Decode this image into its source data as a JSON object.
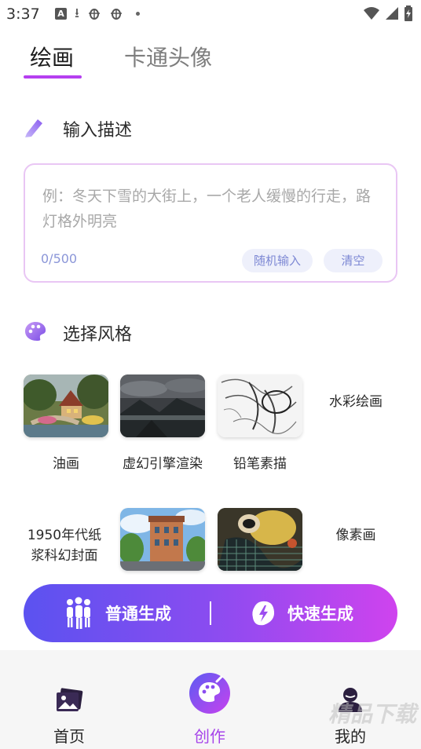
{
  "status_bar": {
    "time": "3:37"
  },
  "tabs": [
    {
      "label": "绘画",
      "active": true
    },
    {
      "label": "卡通头像",
      "active": false
    }
  ],
  "input_section": {
    "title": "输入描述",
    "placeholder": "例：冬天下雪的大街上，一个老人缓慢的行走，路灯格外明亮",
    "count": "0/500",
    "random_label": "随机输入",
    "clear_label": "清空"
  },
  "style_section": {
    "title": "选择风格",
    "styles": [
      {
        "label": "油画",
        "selected": false
      },
      {
        "label": "虚幻引擎渲染",
        "selected": false
      },
      {
        "label": "铅笔素描",
        "selected": false
      },
      {
        "label": "水彩绘画",
        "selected": false
      },
      {
        "label": "1950年代纸浆科幻封面",
        "selected": false
      },
      {
        "label": "",
        "selected": false
      },
      {
        "label": "",
        "selected": false
      },
      {
        "label": "像素画",
        "selected": false
      }
    ]
  },
  "generate": {
    "normal_label": "普通生成",
    "fast_label": "快速生成"
  },
  "bottom_nav": {
    "items": [
      {
        "label": "首页",
        "active": false
      },
      {
        "label": "创作",
        "active": true
      },
      {
        "label": "我的",
        "active": false
      }
    ]
  },
  "watermark": "精品下载",
  "colors": {
    "accent": "#b53ff0",
    "gradient_start": "#5b52f0",
    "gradient_end": "#cf43ee",
    "chip_bg": "#eef0fb",
    "input_border": "#e9c6f4"
  }
}
